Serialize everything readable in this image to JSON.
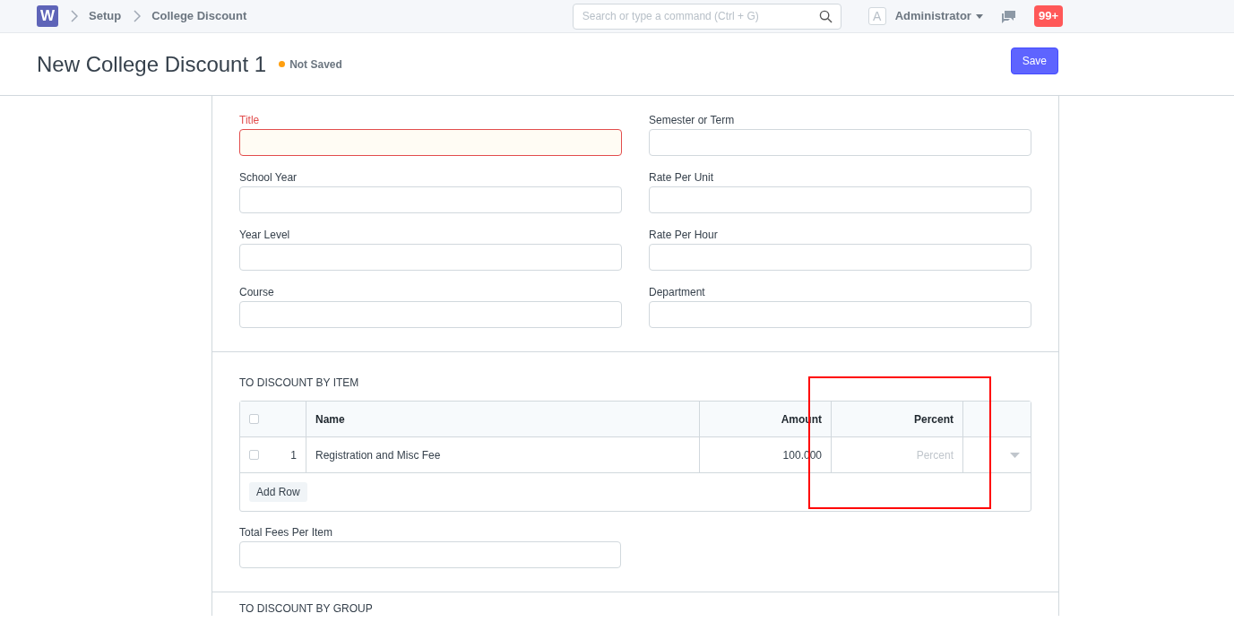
{
  "navbar": {
    "logo": "W",
    "breadcrumbs": [
      "Setup",
      "College Discount"
    ],
    "search": {
      "placeholder": "Search or type a command (Ctrl + G)"
    },
    "user": {
      "avatar": "A",
      "name": "Administrator"
    },
    "notifications": "99+"
  },
  "page": {
    "title": "New College Discount 1",
    "status": "Not Saved",
    "primary_action": "Save"
  },
  "fields": [
    {
      "label": "Title",
      "required": true
    },
    {
      "label": "Semester or Term",
      "required": false
    },
    {
      "label": "School Year",
      "required": false
    },
    {
      "label": "Rate Per Unit",
      "required": false
    },
    {
      "label": "Year Level",
      "required": false
    },
    {
      "label": "Rate Per Hour",
      "required": false
    },
    {
      "label": "Course",
      "required": false
    },
    {
      "label": "Department",
      "required": false
    }
  ],
  "item_section": {
    "heading": "TO DISCOUNT BY ITEM",
    "table": {
      "select_all_checked": false,
      "columns": [
        "Name",
        "Amount",
        "Percent"
      ],
      "rows": [
        {
          "index": "1",
          "checked": false,
          "name": "Registration and Misc Fee",
          "amount": "100.000",
          "percent_placeholder": "Percent"
        }
      ],
      "add_row": "Add Row"
    },
    "total_field": {
      "label": "Total Fees Per Item"
    }
  },
  "highlight": {
    "kind": "frame"
  },
  "next_section": {
    "heading": "TO DISCOUNT BY GROUP"
  }
}
